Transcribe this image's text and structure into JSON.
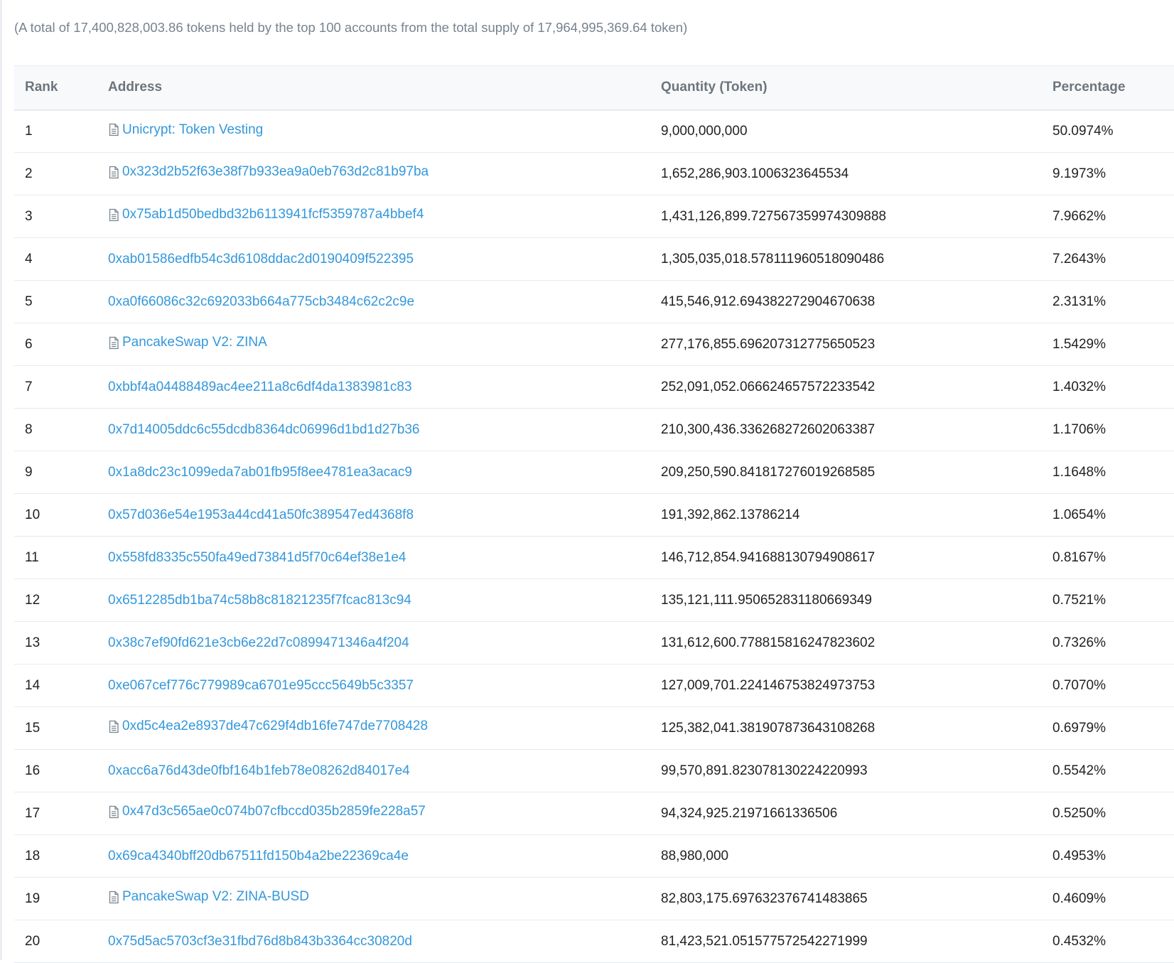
{
  "summary": "(A total of 17,400,828,003.86 tokens held by the top 100 accounts from the total supply of 17,964,995,369.64 token)",
  "table": {
    "headers": {
      "rank": "Rank",
      "address": "Address",
      "quantity": "Quantity (Token)",
      "percentage": "Percentage"
    },
    "rows": [
      {
        "rank": "1",
        "address": "Unicrypt: Token Vesting",
        "contract": true,
        "quantity": "9,000,000,000",
        "percentage": "50.0974%"
      },
      {
        "rank": "2",
        "address": "0x323d2b52f63e38f7b933ea9a0eb763d2c81b97ba",
        "contract": true,
        "quantity": "1,652,286,903.1006323645534",
        "percentage": "9.1973%"
      },
      {
        "rank": "3",
        "address": "0x75ab1d50bedbd32b6113941fcf5359787a4bbef4",
        "contract": true,
        "quantity": "1,431,126,899.727567359974309888",
        "percentage": "7.9662%"
      },
      {
        "rank": "4",
        "address": "0xab01586edfb54c3d6108ddac2d0190409f522395",
        "contract": false,
        "quantity": "1,305,035,018.578111960518090486",
        "percentage": "7.2643%"
      },
      {
        "rank": "5",
        "address": "0xa0f66086c32c692033b664a775cb3484c62c2c9e",
        "contract": false,
        "quantity": "415,546,912.694382272904670638",
        "percentage": "2.3131%"
      },
      {
        "rank": "6",
        "address": "PancakeSwap V2: ZINA",
        "contract": true,
        "quantity": "277,176,855.696207312775650523",
        "percentage": "1.5429%"
      },
      {
        "rank": "7",
        "address": "0xbbf4a04488489ac4ee211a8c6df4da1383981c83",
        "contract": false,
        "quantity": "252,091,052.066624657572233542",
        "percentage": "1.4032%"
      },
      {
        "rank": "8",
        "address": "0x7d14005ddc6c55dcdb8364dc06996d1bd1d27b36",
        "contract": false,
        "quantity": "210,300,436.336268272602063387",
        "percentage": "1.1706%"
      },
      {
        "rank": "9",
        "address": "0x1a8dc23c1099eda7ab01fb95f8ee4781ea3acac9",
        "contract": false,
        "quantity": "209,250,590.841817276019268585",
        "percentage": "1.1648%"
      },
      {
        "rank": "10",
        "address": "0x57d036e54e1953a44cd41a50fc389547ed4368f8",
        "contract": false,
        "quantity": "191,392,862.13786214",
        "percentage": "1.0654%"
      },
      {
        "rank": "11",
        "address": "0x558fd8335c550fa49ed73841d5f70c64ef38e1e4",
        "contract": false,
        "quantity": "146,712,854.941688130794908617",
        "percentage": "0.8167%"
      },
      {
        "rank": "12",
        "address": "0x6512285db1ba74c58b8c81821235f7fcac813c94",
        "contract": false,
        "quantity": "135,121,111.950652831180669349",
        "percentage": "0.7521%"
      },
      {
        "rank": "13",
        "address": "0x38c7ef90fd621e3cb6e22d7c0899471346a4f204",
        "contract": false,
        "quantity": "131,612,600.778815816247823602",
        "percentage": "0.7326%"
      },
      {
        "rank": "14",
        "address": "0xe067cef776c779989ca6701e95ccc5649b5c3357",
        "contract": false,
        "quantity": "127,009,701.224146753824973753",
        "percentage": "0.7070%"
      },
      {
        "rank": "15",
        "address": "0xd5c4ea2e8937de47c629f4db16fe747de7708428",
        "contract": true,
        "quantity": "125,382,041.381907873643108268",
        "percentage": "0.6979%"
      },
      {
        "rank": "16",
        "address": "0xacc6a76d43de0fbf164b1feb78e08262d84017e4",
        "contract": false,
        "quantity": "99,570,891.823078130224220993",
        "percentage": "0.5542%"
      },
      {
        "rank": "17",
        "address": "0x47d3c565ae0c074b07cfbccd035b2859fe228a57",
        "contract": true,
        "quantity": "94,324,925.21971661336506",
        "percentage": "0.5250%"
      },
      {
        "rank": "18",
        "address": "0x69ca4340bff20db67511fd150b4a2be22369ca4e",
        "contract": false,
        "quantity": "88,980,000",
        "percentage": "0.4953%"
      },
      {
        "rank": "19",
        "address": "PancakeSwap V2: ZINA-BUSD",
        "contract": true,
        "quantity": "82,803,175.697632376741483865",
        "percentage": "0.4609%"
      },
      {
        "rank": "20",
        "address": "0x75d5ac5703cf3e31fbd76d8b843b3364cc30820d",
        "contract": false,
        "quantity": "81,423,521.051577572542271999",
        "percentage": "0.4532%"
      }
    ]
  },
  "colors": {
    "link": "#3498db",
    "muted": "#77838f",
    "border": "#e7eaf3"
  },
  "icons": {
    "contract": "file-text-icon"
  }
}
